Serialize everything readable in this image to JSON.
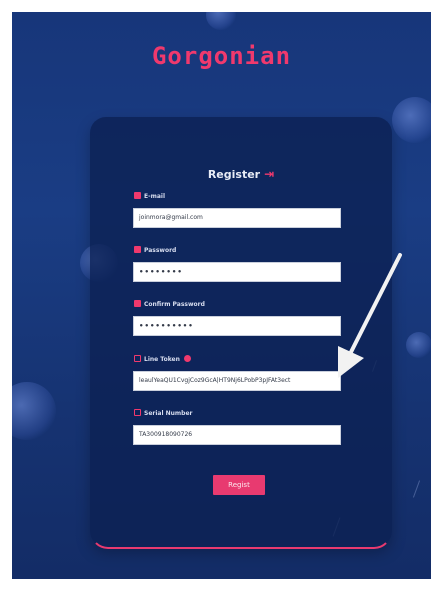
{
  "brand": "Gorgonian",
  "form": {
    "title": "Register",
    "fields": {
      "email": {
        "label": "E-mail",
        "value": "joinmora@gmail.com"
      },
      "password": {
        "label": "Password",
        "value": "••••••••"
      },
      "confirm_password": {
        "label": "Confirm Password",
        "value": "••••••••••"
      },
      "line_token": {
        "label": "Line Token",
        "value": "leaulYeaQU1CvgjCoz9GcA|HT9Nj6LPobP3pJFAt3ect"
      },
      "serial_number": {
        "label": "Serial Number",
        "value": "TA300918090726"
      }
    },
    "submit_label": "Regist"
  },
  "colors": {
    "accent": "#e83a70",
    "background": "#17367a",
    "card": "#0c2052",
    "arrow": "#f2f2f2"
  },
  "icons": {
    "email": "user-icon",
    "password": "lock-icon",
    "confirm_password": "lock-icon",
    "line_token": "token-icon",
    "line_token_help": "help-circle-icon",
    "serial_number": "serial-icon",
    "title": "login-icon"
  }
}
